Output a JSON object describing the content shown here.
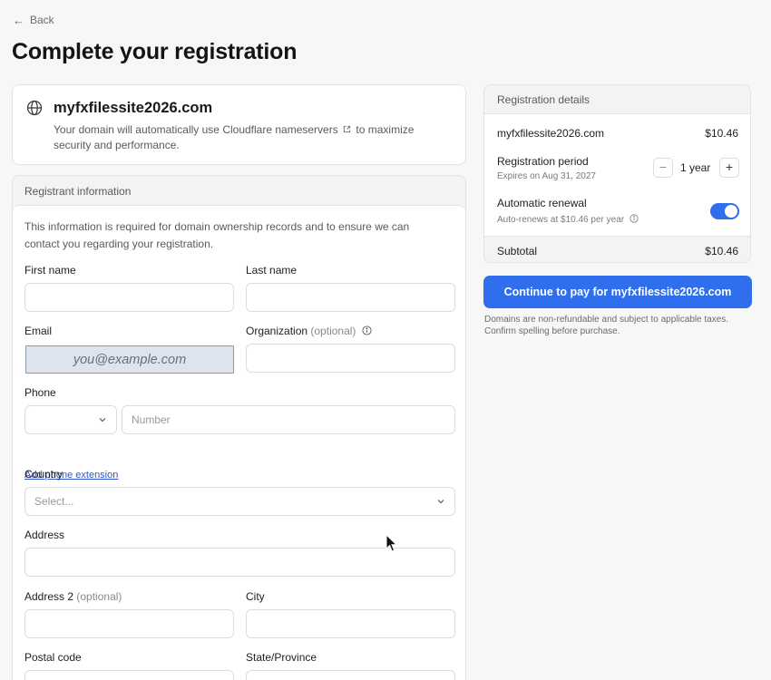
{
  "nav": {
    "back_label": "Back"
  },
  "page": {
    "title": "Complete your registration"
  },
  "domain_card": {
    "domain": "myfxfilessite2026.com",
    "desc_before": "Your domain will automatically use Cloudflare nameservers",
    "desc_after": "to maximize security and performance."
  },
  "registrant": {
    "header": "Registrant information",
    "description": "This information is required for domain ownership records and to ensure we can contact you regarding your registration.",
    "first_name": {
      "label": "First name",
      "value": ""
    },
    "last_name": {
      "label": "Last name",
      "value": ""
    },
    "email": {
      "label": "Email",
      "value": "",
      "placeholder": "you@example.com"
    },
    "organization": {
      "label": "Organization",
      "optional": "(optional)",
      "value": ""
    },
    "phone": {
      "label": "Phone",
      "code_value": "",
      "number_placeholder": "Number"
    },
    "phone_extension_link": "Add phone extension",
    "country": {
      "label": "Country",
      "placeholder": "Select..."
    },
    "address": {
      "label": "Address",
      "value": ""
    },
    "address2": {
      "label": "Address 2",
      "optional": "(optional)",
      "value": ""
    },
    "city": {
      "label": "City",
      "value": ""
    },
    "postal_code": {
      "label": "Postal code",
      "value": ""
    },
    "state": {
      "label": "State/Province",
      "value": ""
    }
  },
  "details": {
    "header": "Registration details",
    "domain": "myfxfilessite2026.com",
    "price": "$10.46",
    "period": {
      "label": "Registration period",
      "expires": "Expires on Aug 31, 2027",
      "minus": "−",
      "value": "1 year",
      "plus": "+"
    },
    "renewal": {
      "label": "Automatic renewal",
      "sub": "Auto-renews at $10.46 per year",
      "enabled": true
    },
    "subtotal_label": "Subtotal",
    "subtotal_value": "$10.46"
  },
  "pay_button": "Continue to pay for myfxfilessite2026.com",
  "disclaimer": "Domains are non-refundable and subject to applicable taxes. Confirm spelling before purchase.",
  "colors": {
    "accent": "#2f6fed",
    "link": "#2f55c8",
    "email_highlight": "#dde4ee"
  }
}
